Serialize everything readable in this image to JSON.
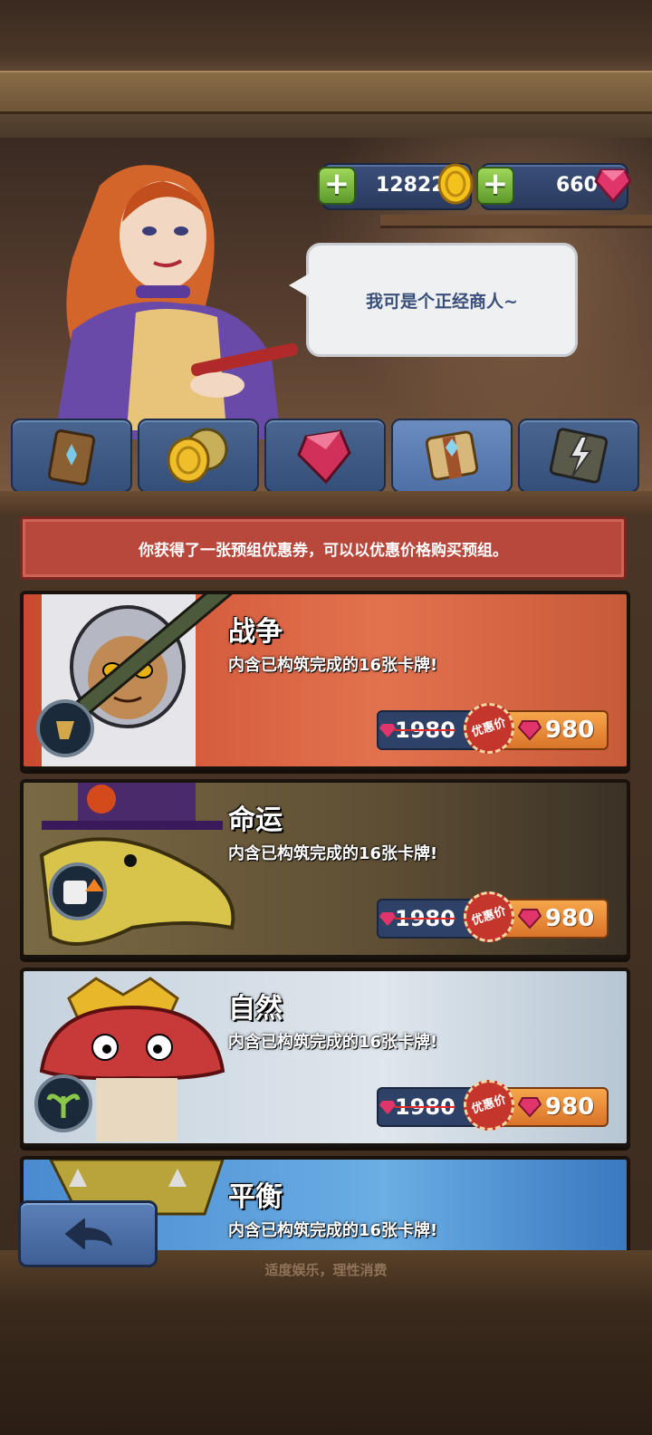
{
  "currency": {
    "gold": "12822",
    "gems": "660"
  },
  "merchant": {
    "speech": "我可是个正经商人~"
  },
  "tabs": [
    {
      "name": "card-pack"
    },
    {
      "name": "gold-coins"
    },
    {
      "name": "gem"
    },
    {
      "name": "deck"
    },
    {
      "name": "thunder-book"
    }
  ],
  "banner": {
    "text": "你获得了一张预组优惠券，可以以优惠价格购买预组。"
  },
  "decks": [
    {
      "name": "战争",
      "desc": "内含已构筑完成的16张卡牌!",
      "old_price": "1980",
      "sale_label": "优惠价",
      "new_price": "980"
    },
    {
      "name": "命运",
      "desc": "内含已构筑完成的16张卡牌!",
      "old_price": "1980",
      "sale_label": "优惠价",
      "new_price": "980"
    },
    {
      "name": "自然",
      "desc": "内含已构筑完成的16张卡牌!",
      "old_price": "1980",
      "sale_label": "优惠价",
      "new_price": "980"
    },
    {
      "name": "平衡",
      "desc": "内含已构筑完成的16张卡牌!"
    }
  ],
  "footer": {
    "notice": "适度娱乐，理性消费"
  },
  "colors": {
    "war": "#d4573a",
    "fate": "#6b5a3a",
    "nature": "#b8c8d8",
    "balance": "#3a7ac8"
  }
}
